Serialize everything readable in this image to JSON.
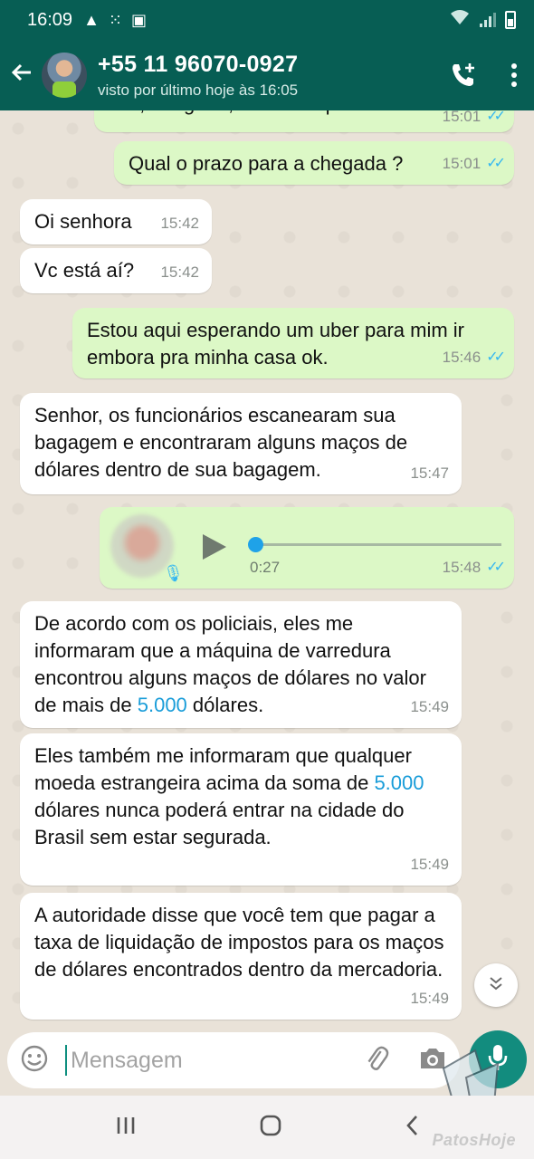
{
  "status_bar": {
    "time": "16:09"
  },
  "header": {
    "contact_name": "+55 11 96070-0927",
    "last_seen": "visto por último hoje às 16:05"
  },
  "messages": [
    {
      "dir": "out",
      "text": "Ok, obrigada, estarei esperando",
      "time": "15:01",
      "ticks": "✓✓"
    },
    {
      "dir": "out",
      "text": "Qual o prazo para a chegada ?",
      "time": "15:01",
      "ticks": "✓✓"
    },
    {
      "dir": "in",
      "text": "Oi senhora",
      "time": "15:42"
    },
    {
      "dir": "in",
      "text": "Vc está aí?",
      "time": "15:42"
    },
    {
      "dir": "out",
      "text": "Estou aqui esperando um uber para mim ir embora pra  minha casa ok.",
      "time": "15:46",
      "ticks": "✓✓"
    },
    {
      "dir": "in",
      "text": "Senhor, os funcionários escanearam sua bagagem e encontraram alguns maços de dólares dentro de sua bagagem.",
      "time": "15:47"
    },
    {
      "dir": "out",
      "type": "audio",
      "duration": "0:27",
      "time": "15:48",
      "ticks": "✓✓",
      "progress": 0
    },
    {
      "dir": "in",
      "text_before": "De acordo com os policiais, eles me informaram que a máquina de varredura encontrou alguns maços de dólares no valor de mais de ",
      "amount": "5.000",
      "text_after": " dólares.",
      "time": "15:49"
    },
    {
      "dir": "in",
      "text_before": "Eles também me informaram que qualquer moeda estrangeira acima da soma de ",
      "amount": "5.000",
      "text_after": " dólares nunca poderá entrar na cidade do Brasil sem estar segurada.",
      "time": "15:49"
    },
    {
      "dir": "in",
      "text": "A autoridade disse que você tem que pagar a taxa de liquidação de impostos para os maços de dólares encontrados dentro da mercadoria.",
      "time": "15:49"
    }
  ],
  "composer": {
    "placeholder": "Mensagem"
  },
  "watermark": "PatosHoje",
  "colors": {
    "header": "#075e54",
    "outgoing": "#dcf8c6",
    "incoming": "#ffffff",
    "accent": "#128c7e",
    "tick": "#34b7f1"
  },
  "icons": [
    "back-arrow-icon",
    "add-call-icon",
    "more-vert-icon",
    "emoji-icon",
    "attach-icon",
    "camera-icon",
    "mic-icon",
    "play-icon",
    "scroll-down-icon",
    "recents-icon",
    "home-icon",
    "back-nav-icon"
  ]
}
